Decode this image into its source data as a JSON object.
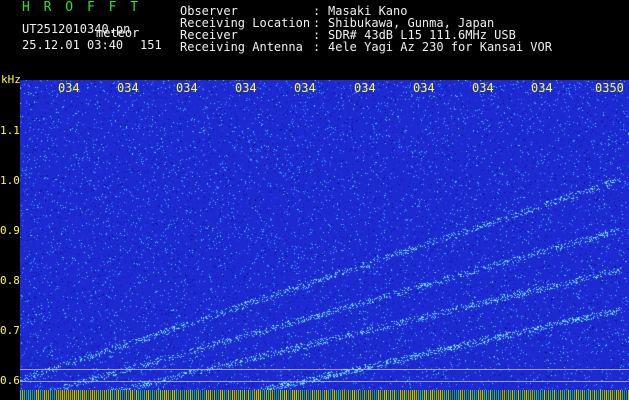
{
  "header": {
    "title": "H R O F F T",
    "filename": "UT2512010340.pn",
    "meteor_label": "meteor",
    "datetime": "25.12.01 03:40",
    "count": "151"
  },
  "info": [
    {
      "label": "Observer",
      "value": "Masaki Kano"
    },
    {
      "label": "Receiving Location",
      "value": "Shibukawa, Gunma, Japan"
    },
    {
      "label": "Receiver",
      "value": "SDR# 43dB L15 111.6MHz USB"
    },
    {
      "label": "Receiving Antenna",
      "value": "4ele Yagi Az 230 for Kansai VOR"
    }
  ],
  "colon": ":",
  "plot": {
    "unit": "kHz",
    "time_labels": [
      "034",
      "034",
      "034",
      "034",
      "034",
      "034",
      "034",
      "034",
      "034",
      "0350"
    ],
    "freq_labels": [
      "1.1",
      "1.0",
      "0.9",
      "0.8",
      "0.7",
      "0.6"
    ],
    "background_color": "#1d2ad2",
    "label_color": "#ffff33",
    "title_color": "#2fe02f"
  }
}
